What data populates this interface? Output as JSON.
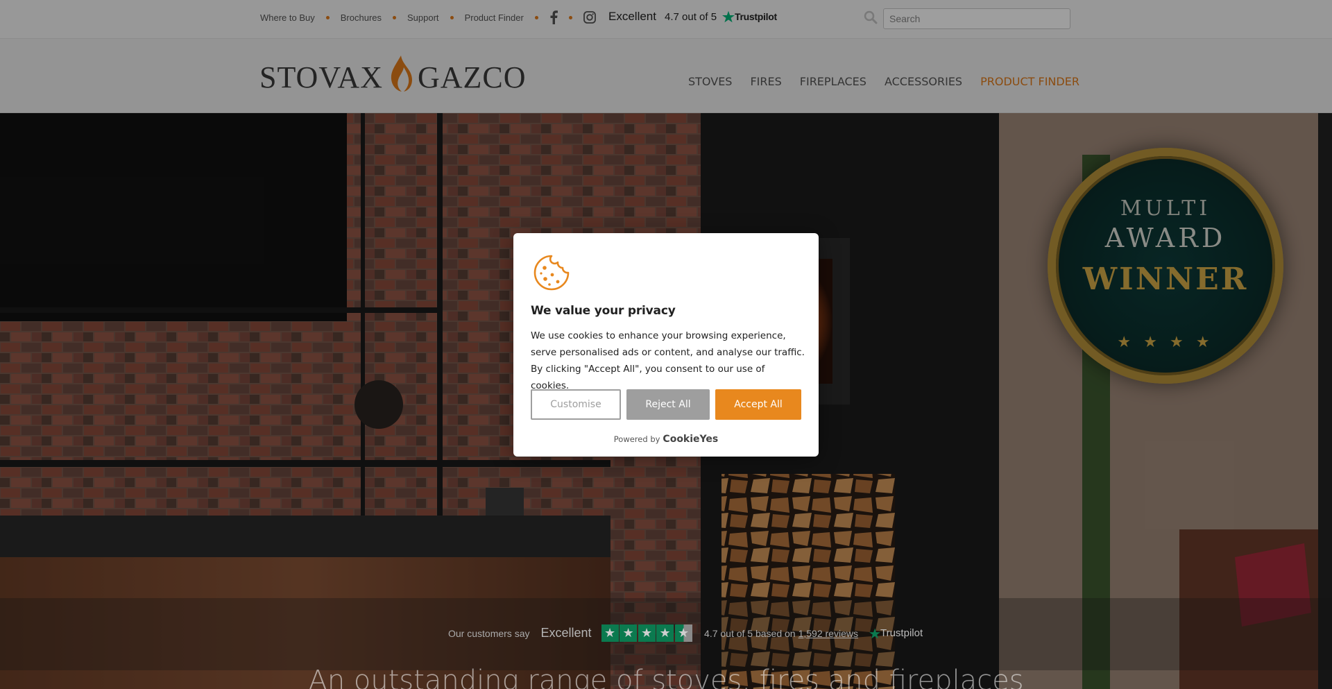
{
  "topbar": {
    "links": [
      "Where to Buy",
      "Brochures",
      "Support",
      "Product Finder"
    ],
    "social_icons": [
      "facebook-icon",
      "instagram-icon"
    ],
    "trustpilot": {
      "rating_word": "Excellent",
      "score": "4.7 out of 5",
      "brand": "Trustpilot"
    },
    "search": {
      "placeholder": "Search",
      "value": ""
    }
  },
  "header": {
    "logo": {
      "left": "STOVAX",
      "right": "GAZCO"
    },
    "nav": [
      "STOVES",
      "FIRES",
      "FIREPLACES",
      "ACCESSORIES",
      "PRODUCT FINDER"
    ]
  },
  "hero": {
    "award": {
      "line1": "MULTI",
      "line2": "AWARD",
      "line3": "WINNER",
      "stars": "★ ★ ★ ★"
    },
    "trustpilot_bar": {
      "lead": "Our customers say",
      "rating_word": "Excellent",
      "stars": 4.5,
      "score_text": "4.7 out of 5 based on",
      "reviews": "1,592 reviews",
      "brand": "Trustpilot"
    },
    "tagline": "An outstanding range of stoves, fires and fireplaces"
  },
  "cookie_modal": {
    "title": "We value your privacy",
    "body": "We use cookies to enhance your browsing experience, serve personalised ads or content, and analyse our traffic. By clicking \"Accept All\", you consent to our use of cookies.",
    "buttons": {
      "customise": "Customise",
      "reject": "Reject All",
      "accept": "Accept All"
    },
    "powered_by": "Powered by",
    "powered_brand": "CookieYes"
  },
  "colors": {
    "accent": "#e07b1a",
    "accept_button": "#e8881e",
    "reject_button": "#9e9e9e",
    "trustpilot_green": "#0b7a4f"
  }
}
